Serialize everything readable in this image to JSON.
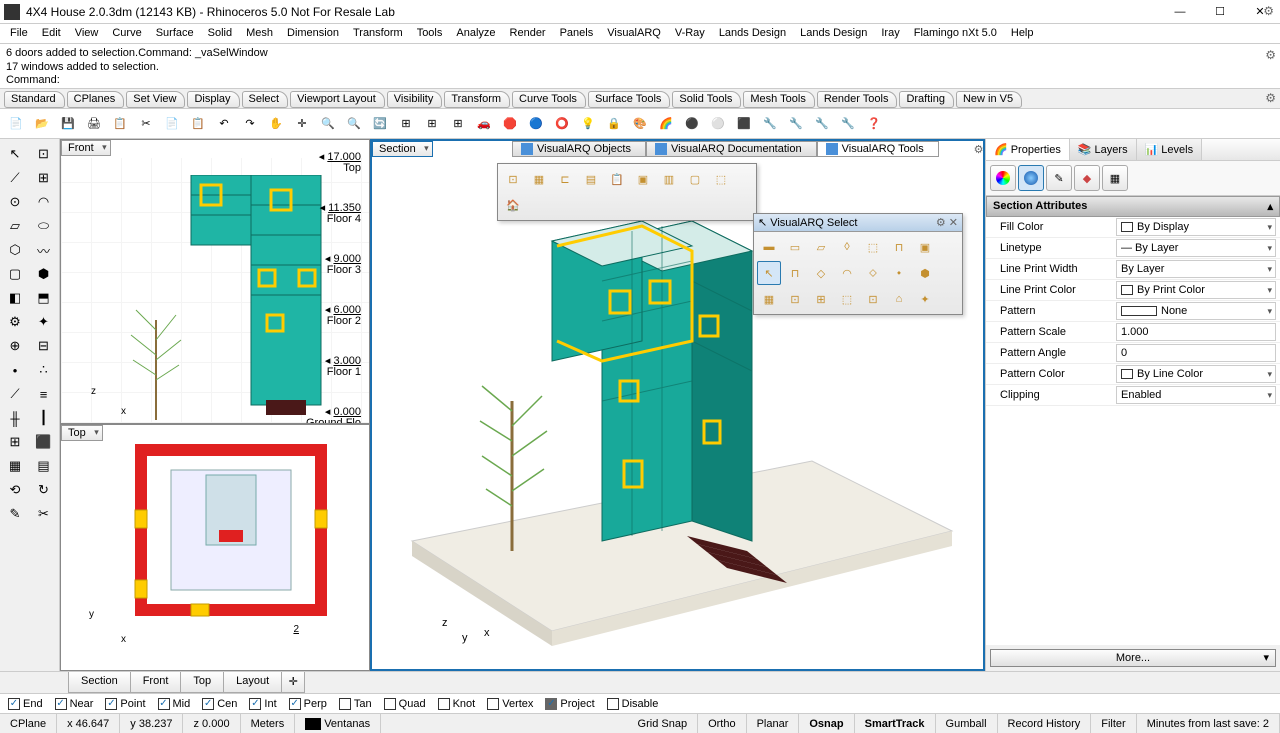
{
  "title": "4X4 House 2.0.3dm (12143 KB) - Rhinoceros 5.0 Not For Resale Lab",
  "menu": [
    "File",
    "Edit",
    "View",
    "Curve",
    "Surface",
    "Solid",
    "Mesh",
    "Dimension",
    "Transform",
    "Tools",
    "Analyze",
    "Render",
    "Panels",
    "VisualARQ",
    "V-Ray",
    "Lands Design",
    "Lands Design",
    "Iray",
    "Flamingo nXt 5.0",
    "Help"
  ],
  "cmd": {
    "l1": "6 doors added to selection.Command: _vaSelWindow",
    "l2": "17 windows added to selection.",
    "prompt": "Command:"
  },
  "tabs": [
    "Standard",
    "CPlanes",
    "Set View",
    "Display",
    "Select",
    "Viewport Layout",
    "Visibility",
    "Transform",
    "Curve Tools",
    "Surface Tools",
    "Solid Tools",
    "Mesh Tools",
    "Render Tools",
    "Drafting",
    "New in V5"
  ],
  "viewports": {
    "front": "Front",
    "top": "Top",
    "section": "Section"
  },
  "levels": [
    {
      "h": "17.000",
      "n": "Top"
    },
    {
      "h": "11.350",
      "n": "Floor 4"
    },
    {
      "h": "9.000",
      "n": "Floor 3"
    },
    {
      "h": "6.000",
      "n": "Floor 2"
    },
    {
      "h": "3.000",
      "n": "Floor 1"
    },
    {
      "h": "0.000",
      "n": "Ground Flo"
    }
  ],
  "vpTabs": [
    {
      "label": "VisualARQ Objects",
      "active": false
    },
    {
      "label": "VisualARQ Documentation",
      "active": false
    },
    {
      "label": "VisualARQ Tools",
      "active": true
    }
  ],
  "floatSelect": {
    "title": "VisualARQ Select"
  },
  "panelTabs": [
    {
      "label": "Properties",
      "active": true
    },
    {
      "label": "Layers",
      "active": false
    },
    {
      "label": "Levels",
      "active": false
    }
  ],
  "sectionHdr": "Section Attributes",
  "props": [
    {
      "label": "Fill Color",
      "val": "By Display",
      "sw": "#fff",
      "dd": true
    },
    {
      "label": "Linetype",
      "val": "— By Layer",
      "dd": true
    },
    {
      "label": "Line Print Width",
      "val": "By Layer",
      "dd": true
    },
    {
      "label": "Line Print Color",
      "val": "By Print Color",
      "sw": "#fff",
      "dd": true
    },
    {
      "label": "Pattern",
      "val": "None",
      "sw": "#fff",
      "dd": true,
      "box": true
    },
    {
      "label": "Pattern Scale",
      "val": "1.000"
    },
    {
      "label": "Pattern Angle",
      "val": "0"
    },
    {
      "label": "Pattern Color",
      "val": "By Line Color",
      "sw": "#fff",
      "dd": true
    },
    {
      "label": "Clipping",
      "val": "Enabled",
      "dd": true
    }
  ],
  "moreLabel": "More...",
  "viewTabs": [
    "Section",
    "Front",
    "Top",
    "Layout"
  ],
  "osnap": [
    {
      "l": "End",
      "c": true
    },
    {
      "l": "Near",
      "c": true
    },
    {
      "l": "Point",
      "c": true
    },
    {
      "l": "Mid",
      "c": true
    },
    {
      "l": "Cen",
      "c": true
    },
    {
      "l": "Int",
      "c": true
    },
    {
      "l": "Perp",
      "c": true
    },
    {
      "l": "Tan",
      "c": false
    },
    {
      "l": "Quad",
      "c": false
    },
    {
      "l": "Knot",
      "c": false
    },
    {
      "l": "Vertex",
      "c": false
    },
    {
      "l": "Project",
      "c": true,
      "fill": true
    },
    {
      "l": "Disable",
      "c": false
    }
  ],
  "status": {
    "cplane": "CPlane",
    "x": "x 46.647",
    "y": "y 38.237",
    "z": "z 0.000",
    "units": "Meters",
    "layer": "Ventanas",
    "items": [
      "Grid Snap",
      "Ortho",
      "Planar",
      "Osnap",
      "SmartTrack",
      "Gumball",
      "Record History",
      "Filter"
    ],
    "bold": [
      "Osnap",
      "SmartTrack"
    ],
    "right": "Minutes from last save: 2"
  }
}
